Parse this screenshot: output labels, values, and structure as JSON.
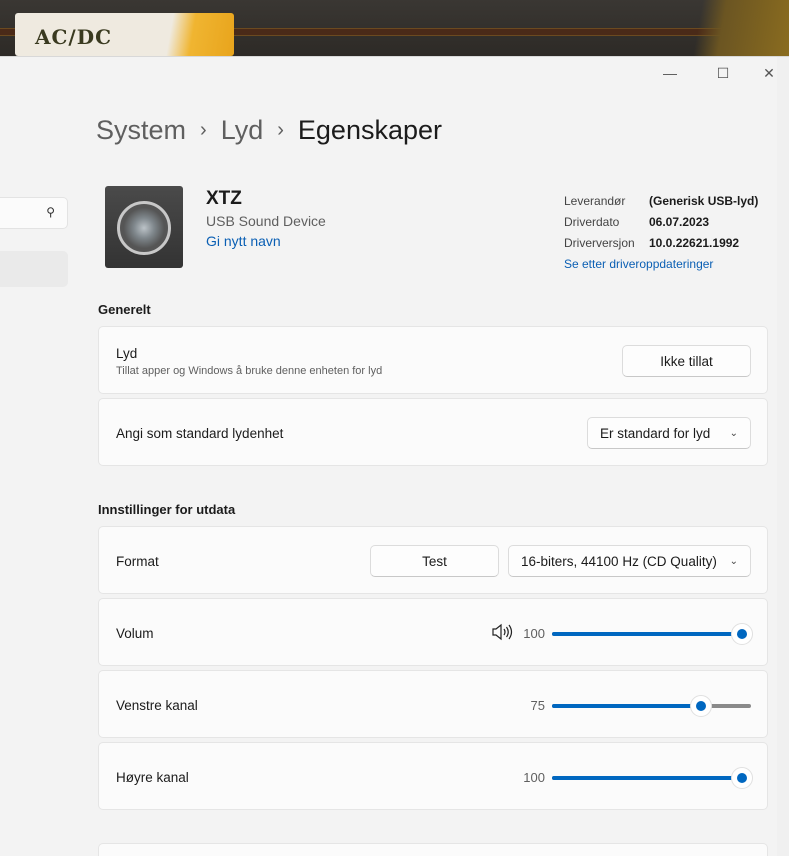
{
  "window": {
    "minimize": "—",
    "maximize": "☐",
    "close": "✕"
  },
  "search": {
    "icon": "search-icon",
    "glyph": "⚲"
  },
  "breadcrumb": [
    "System",
    "Lyd",
    "Egenskaper"
  ],
  "breadcrumb_sep": "›",
  "device": {
    "name": "XTZ",
    "type": "USB Sound Device",
    "rename": "Gi nytt navn"
  },
  "info": {
    "rows": [
      {
        "k": "Leverandør",
        "v": "(Generisk USB-lyd)"
      },
      {
        "k": "Driverdato",
        "v": "06.07.2023"
      },
      {
        "k": "Driverversjon",
        "v": "10.0.22621.1992"
      }
    ],
    "link": "Se etter driveroppdateringer"
  },
  "general": {
    "heading": "Generelt",
    "audio": {
      "label": "Lyd",
      "desc": "Tillat apper og Windows å bruke denne enheten for lyd",
      "button": "Ikke tillat"
    },
    "default": {
      "label": "Angi som standard lydenhet",
      "value": "Er standard for lyd"
    }
  },
  "output": {
    "heading": "Innstillinger for utdata",
    "format": {
      "label": "Format",
      "test": "Test",
      "value": "16-biters, 44100 Hz (CD Quality)"
    },
    "volume": {
      "label": "Volum",
      "value": "100",
      "percent": 100
    },
    "left": {
      "label": "Venstre kanal",
      "value": "75",
      "percent": 75
    },
    "right": {
      "label": "Høyre kanal",
      "value": "100",
      "percent": 100
    }
  },
  "chev": "⌄",
  "accent": "#0067c0"
}
